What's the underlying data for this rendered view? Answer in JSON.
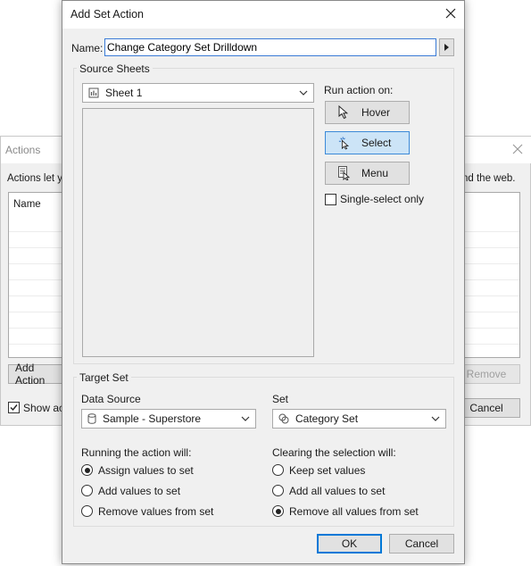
{
  "background_dialog": {
    "title": "Actions",
    "description_left": "Actions let yo",
    "description_right": "nd the web.",
    "list_header": "Name",
    "add_button": "Add Action",
    "remove_button": "Remove",
    "cancel_button": "Cancel",
    "show_checkbox_label": "Show acti",
    "show_checkbox_checked": true
  },
  "dialog": {
    "title": "Add Set Action",
    "name_label": "Name:",
    "name_value": "Change Category Set Drilldown",
    "source_sheets": {
      "title": "Source Sheets",
      "selected_sheet": "Sheet 1"
    },
    "run_action_on": {
      "label": "Run action on:",
      "options": [
        {
          "label": "Hover",
          "icon": "pointer-icon",
          "selected": false
        },
        {
          "label": "Select",
          "icon": "select-pointer-icon",
          "selected": true
        },
        {
          "label": "Menu",
          "icon": "menu-icon",
          "selected": false
        }
      ],
      "single_select_label": "Single-select only",
      "single_select_checked": false
    },
    "target_set": {
      "title": "Target Set",
      "data_source_label": "Data Source",
      "data_source_value": "Sample - Superstore",
      "set_label": "Set",
      "set_value": "Category Set"
    },
    "running_action": {
      "label": "Running the action will:",
      "options": [
        {
          "label": "Assign values to set",
          "selected": true
        },
        {
          "label": "Add values to set",
          "selected": false
        },
        {
          "label": "Remove values from set",
          "selected": false
        }
      ]
    },
    "clearing_selection": {
      "label": "Clearing the selection will:",
      "options": [
        {
          "label": "Keep set values",
          "selected": false
        },
        {
          "label": "Add all values to set",
          "selected": false
        },
        {
          "label": "Remove all values from set",
          "selected": true
        }
      ]
    },
    "ok_button": "OK",
    "cancel_button": "Cancel"
  },
  "colors": {
    "dialog_bg": "#f0f0f0",
    "selected_button_bg": "#cce4f7",
    "selected_button_border": "#3c8ad8",
    "focus_blue": "#0078d7"
  }
}
